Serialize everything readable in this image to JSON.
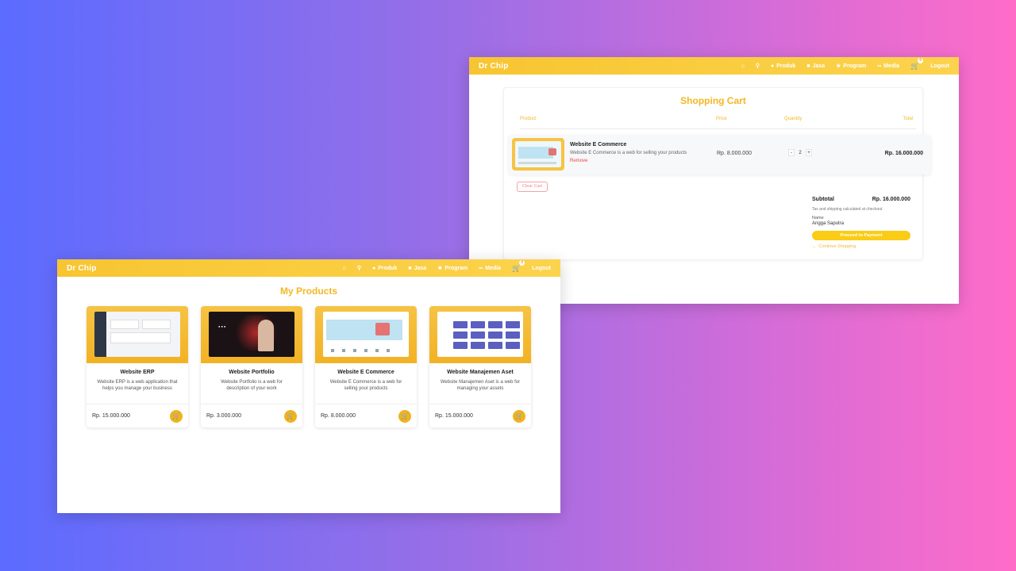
{
  "colors": {
    "accent": "#f2b824",
    "navbar": "#fcd34d",
    "remove": "#ef4444",
    "button": "#facc15"
  },
  "nav": {
    "brand": "Dr Chip",
    "home_icon": "home-icon",
    "search_icon": "search-icon",
    "items": [
      {
        "label": "Produk",
        "icon": "tag-icon"
      },
      {
        "label": "Jasa",
        "icon": "briefcase-icon"
      },
      {
        "label": "Program",
        "icon": "star-icon"
      },
      {
        "label": "Media",
        "icon": "link-icon"
      }
    ],
    "cart_count": "0",
    "logout": "Logout"
  },
  "cart": {
    "title": "Shopping Cart",
    "headers": {
      "product": "Product",
      "price": "Price",
      "quantity": "Quantity",
      "total": "Total"
    },
    "items": [
      {
        "name": "Website E Commerce",
        "description": "Website E Commerce is a web for selling your products",
        "remove": "Remove",
        "price": "Rp. 8.000.000",
        "quantity": "2",
        "total": "Rp. 16.000.000"
      }
    ],
    "clear": "Clear Cart",
    "subtotal_label": "Subtotal",
    "subtotal_value": "Rp. 16.000.000",
    "tax_note": "Tax and shipping calculated at checkout",
    "name_label": "Name",
    "name_value": "Angga Saputra",
    "pay_button": "Proceed to Payment",
    "continue": "Continue Shopping"
  },
  "products": {
    "title": "My Products",
    "items": [
      {
        "name": "Website ERP",
        "description": "Website ERP is a web application that helps you manage your business",
        "price": "Rp. 15.000.000"
      },
      {
        "name": "Website Portfolio",
        "description": "Website Portfolio is a web for description of your work",
        "price": "Rp. 3.000.000"
      },
      {
        "name": "Website E Commerce",
        "description": "Website E Commerce is a web for selling your products",
        "price": "Rp. 8.000.000"
      },
      {
        "name": "Website Manajemen Aset",
        "description": "Website Manajemen Aset is a web for managing your assets",
        "price": "Rp. 15.000.000"
      }
    ]
  }
}
